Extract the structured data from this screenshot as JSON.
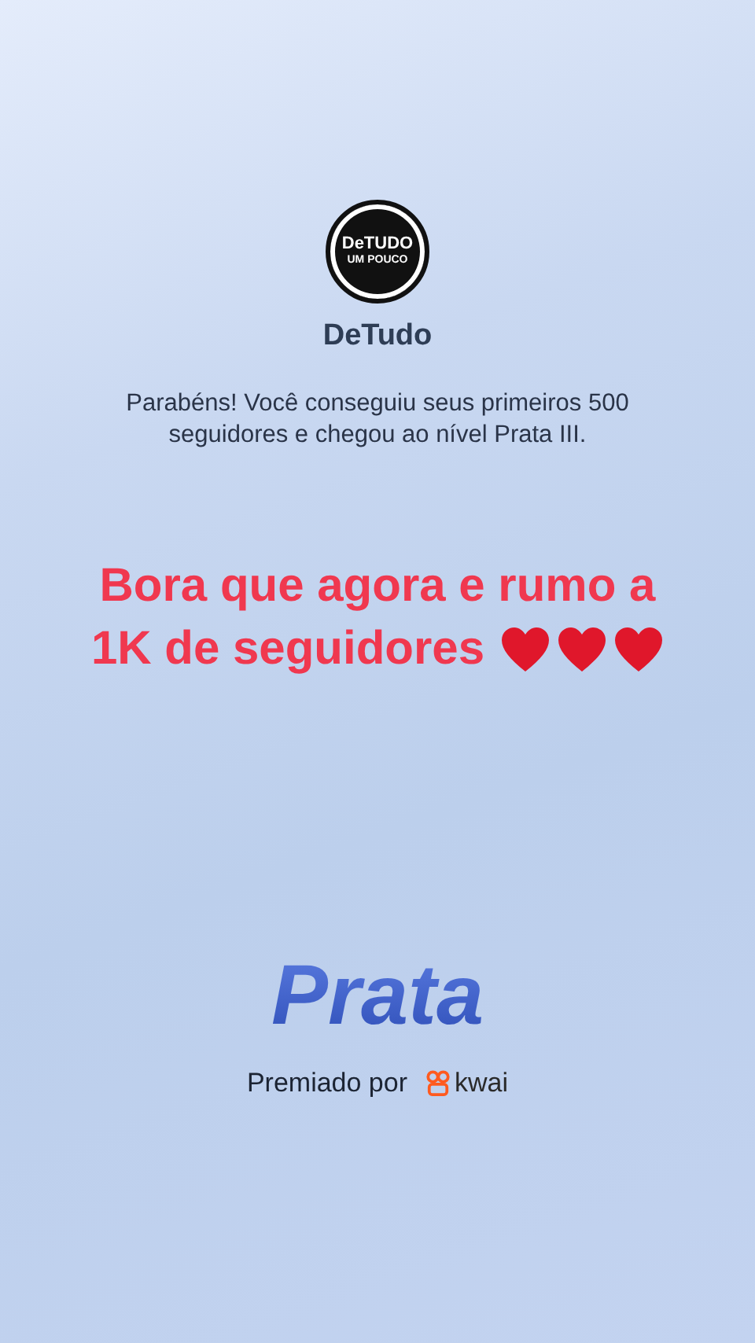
{
  "profile": {
    "logo_lines": [
      "DeTUDO",
      "UM POUCO"
    ],
    "name": "DeTudo"
  },
  "message": "Parabéns! Você conseguiu seus primeiros 500 seguidores e chegou ao nível Prata III.",
  "caption": {
    "lines": [
      "Bora que agora e rumo a",
      "1K de seguidores"
    ],
    "emojis": [
      {
        "kind": "heart"
      },
      {
        "kind": "heart"
      },
      {
        "kind": "heart"
      }
    ]
  },
  "level": "Prata",
  "award": {
    "label": "Premiado por",
    "brand": "kwai"
  }
}
